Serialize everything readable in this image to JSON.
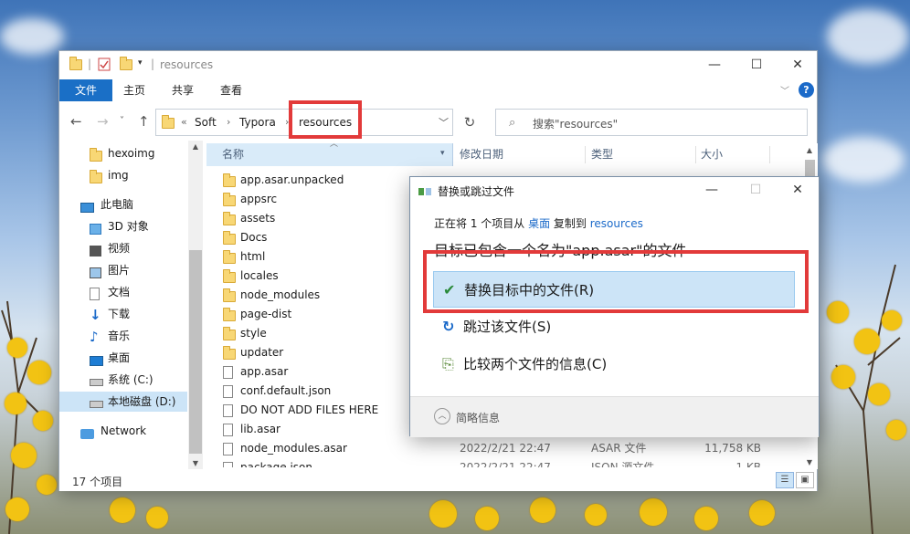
{
  "window": {
    "title": "resources",
    "controls": {
      "minimize": "—",
      "maximize": "☐",
      "close": "✕"
    }
  },
  "ribbon": {
    "file": "文件",
    "tabs": [
      "主页",
      "共享",
      "查看"
    ],
    "help": "?"
  },
  "address": {
    "overflow": "«",
    "parts": [
      "Soft",
      "Typora",
      "resources"
    ],
    "separator": "›"
  },
  "search": {
    "placeholder": "搜索\"resources\""
  },
  "nav_pane": {
    "items": [
      {
        "label": "hexoimg",
        "icon": "folder-icon"
      },
      {
        "label": "img",
        "icon": "folder-icon"
      },
      {
        "label": "此电脑",
        "icon": "computer-icon"
      },
      {
        "label": "3D 对象",
        "icon": "3d-objects-icon"
      },
      {
        "label": "视频",
        "icon": "video-icon"
      },
      {
        "label": "图片",
        "icon": "pictures-icon"
      },
      {
        "label": "文档",
        "icon": "documents-icon"
      },
      {
        "label": "下载",
        "icon": "download-icon"
      },
      {
        "label": "音乐",
        "icon": "music-icon"
      },
      {
        "label": "桌面",
        "icon": "desktop-icon"
      },
      {
        "label": "系统 (C:)",
        "icon": "drive-icon"
      },
      {
        "label": "本地磁盘 (D:)",
        "icon": "drive-icon"
      },
      {
        "label": "Network",
        "icon": "network-icon"
      }
    ]
  },
  "columns": [
    "名称",
    "修改日期",
    "类型",
    "大小"
  ],
  "files": [
    {
      "name": "app.asar.unpacked",
      "kind": "folder",
      "date": "",
      "type": "",
      "size": ""
    },
    {
      "name": "appsrc",
      "kind": "folder",
      "date": "",
      "type": "",
      "size": ""
    },
    {
      "name": "assets",
      "kind": "folder",
      "date": "",
      "type": "",
      "size": ""
    },
    {
      "name": "Docs",
      "kind": "folder",
      "date": "",
      "type": "",
      "size": ""
    },
    {
      "name": "html",
      "kind": "folder",
      "date": "",
      "type": "",
      "size": ""
    },
    {
      "name": "locales",
      "kind": "folder",
      "date": "",
      "type": "",
      "size": ""
    },
    {
      "name": "node_modules",
      "kind": "folder",
      "date": "",
      "type": "",
      "size": ""
    },
    {
      "name": "page-dist",
      "kind": "folder",
      "date": "",
      "type": "",
      "size": ""
    },
    {
      "name": "style",
      "kind": "folder",
      "date": "",
      "type": "",
      "size": ""
    },
    {
      "name": "updater",
      "kind": "folder",
      "date": "",
      "type": "",
      "size": ""
    },
    {
      "name": "app.asar",
      "kind": "file",
      "date": "",
      "type": "",
      "size": ""
    },
    {
      "name": "conf.default.json",
      "kind": "file",
      "date": "",
      "type": "",
      "size": ""
    },
    {
      "name": "DO NOT ADD FILES HERE",
      "kind": "file",
      "date": "",
      "type": "",
      "size": ""
    },
    {
      "name": "lib.asar",
      "kind": "file",
      "date": "",
      "type": "",
      "size": ""
    },
    {
      "name": "node_modules.asar",
      "kind": "file",
      "date": "2022/2/21 22:47",
      "type": "ASAR 文件",
      "size": "11,758 KB"
    },
    {
      "name": "package.json",
      "kind": "file",
      "date": "2022/2/21 22:47",
      "type": "JSON 源文件",
      "size": "1 KB"
    }
  ],
  "status": {
    "item_count": "17 个项目"
  },
  "dialog": {
    "title": "替换或跳过文件",
    "line_prefix": "正在将 1 个项目从 ",
    "from": "桌面",
    "line_mid": " 复制到 ",
    "to": "resources",
    "heading": "目标已包含一个名为\"app.asar\"的文件",
    "options": [
      {
        "label": "替换目标中的文件(R)",
        "icon": "checkmark-icon"
      },
      {
        "label": "跳过该文件(S)",
        "icon": "skip-icon"
      },
      {
        "label": "比较两个文件的信息(C)",
        "icon": "compare-icon"
      }
    ],
    "footer": "简略信息",
    "controls": {
      "minimize": "—",
      "maximize": "☐",
      "close": "✕"
    }
  },
  "colors": {
    "accent": "#1a6fc6",
    "selection": "#cce4f7",
    "highlight_box": "#e23a3a",
    "folder": "#f8d775"
  }
}
